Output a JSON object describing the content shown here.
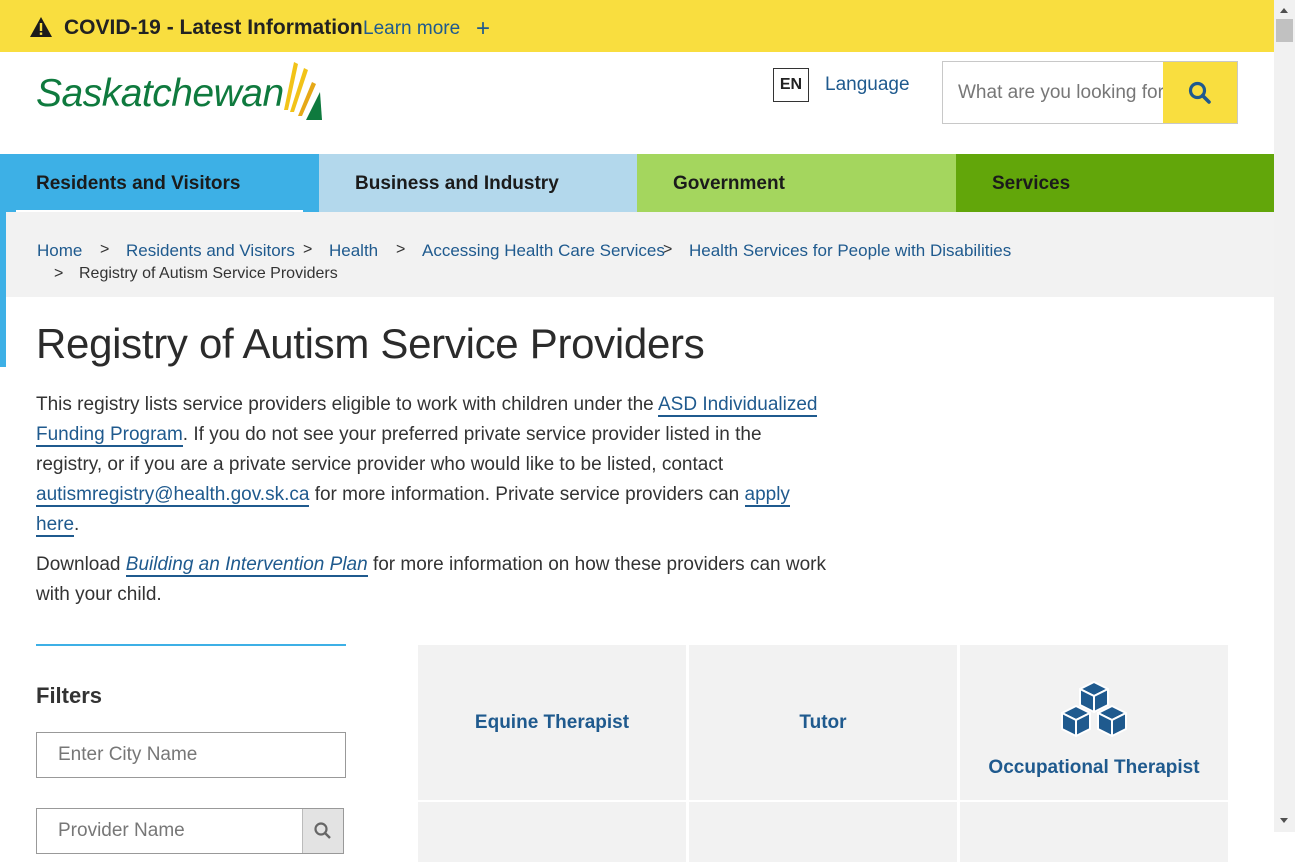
{
  "covid_banner": {
    "title": "COVID-19 - Latest Information",
    "learn_more": "Learn more",
    "expand": "+",
    "icon": "warning-icon",
    "background": "#f9de3f"
  },
  "header": {
    "logo_text": "Saskatchewan",
    "language_code": "EN",
    "language_label": "Language",
    "search_placeholder": "What are you looking for?",
    "search_icon": "search-icon"
  },
  "nav": {
    "tabs": [
      {
        "label": "Residents and Visitors",
        "color": "#3db0e6",
        "active": true
      },
      {
        "label": "Business and Industry",
        "color": "#b3d8ec"
      },
      {
        "label": "Government",
        "color": "#a4d65e"
      },
      {
        "label": "Services",
        "color": "#62a60a"
      }
    ]
  },
  "breadcrumb": {
    "items": [
      "Home",
      "Residents and Visitors",
      "Health",
      "Accessing Health Care Services",
      "Health Services for People with Disabilities"
    ],
    "current": "Registry of Autism Service Providers",
    "separator": ">"
  },
  "page": {
    "title": "Registry of Autism Service Providers",
    "intro": {
      "p1_a": "This registry lists service providers eligible to work with children under the ",
      "link_funding_1": "ASD Individualized",
      "link_funding_2": "Funding Program",
      "p1_b": ". If you do not see your preferred private service provider listed in the registry, or if you are a private service provider who would like to be listed, contact ",
      "link_email": "autismregistry@health.gov.sk.ca",
      "p1_c": " for more information. Private service providers can ",
      "link_apply_1": "apply",
      "link_apply_2": "here",
      "p1_d": "."
    },
    "download": {
      "prefix": "Download ",
      "link": "Building an Intervention Plan",
      "suffix": " for more information on how these providers can work with your child."
    }
  },
  "filters": {
    "heading": "Filters",
    "city_placeholder": "Enter City Name",
    "provider_placeholder": "Provider Name",
    "provider_search_icon": "search-icon"
  },
  "tiles": [
    {
      "label": "Equine Therapist"
    },
    {
      "label": "Tutor"
    },
    {
      "label": "Occupational Therapist",
      "icon": "cubes-icon"
    }
  ],
  "colors": {
    "link": "#1f5a8e",
    "accent_blue": "#3db0e6",
    "logo_green": "#0f7a3e"
  }
}
